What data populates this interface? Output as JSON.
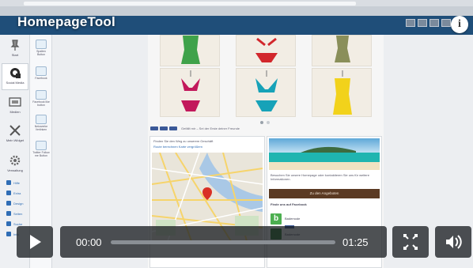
{
  "video": {
    "title": "HomepageTool",
    "info_label": "i",
    "current_time": "00:00",
    "duration": "01:25",
    "progress": 0.0
  },
  "sidebar": {
    "nav": [
      {
        "label": "Start"
      },
      {
        "label": "Social Media"
      },
      {
        "label": "Medien"
      },
      {
        "label": "Mein Widget"
      },
      {
        "label": "Verwaltung"
      }
    ],
    "tools": [
      {
        "label": "Spalten Button"
      },
      {
        "label": "Facebook"
      },
      {
        "label": "Facebook like button"
      },
      {
        "label": "Netzwerke Verlinken"
      },
      {
        "label": "Twitter Follow me Button"
      }
    ],
    "links": [
      "Hilfe",
      "Extra",
      "Design",
      "Seiten",
      "Suche",
      "Info"
    ]
  },
  "page": {
    "intro_text": "Finden Sie den Weg zu unserem Geschäft",
    "map_links": "Route berechnen   Karte vergrößern",
    "share_text": "Gefällt mir – Sei der Erste deiner Freunde",
    "promo_text": "Besuchen Sie unsere Homepage oder kontaktieren Sie uns für weitere Informationen.",
    "promo_button": "Zu den Angeboten",
    "fb_title": "Finde uns auf Facebook",
    "fb_name_1": "Bademode",
    "fb_name_2": "Bademode"
  },
  "colors": {
    "header": "#1f4e79",
    "accent_blue": "#2f6db5",
    "promo_button": "#5b3a23",
    "controls_bg": "#1c2024"
  },
  "icons": {
    "play": "play-icon",
    "fullscreen": "fullscreen-icon",
    "volume": "volume-icon",
    "info": "info-icon"
  }
}
